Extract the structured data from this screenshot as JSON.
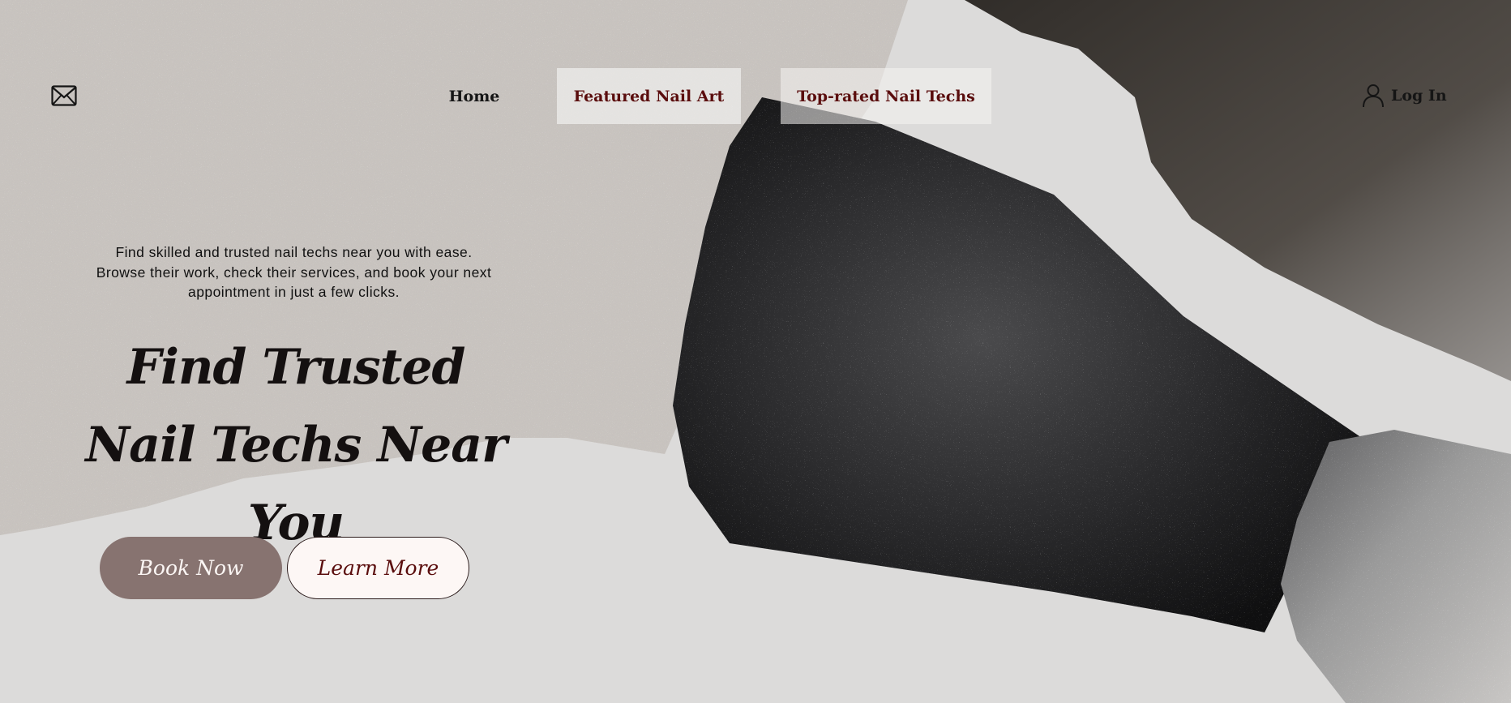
{
  "nav": {
    "mail_icon": "envelope-icon",
    "items": [
      {
        "label": "Home"
      },
      {
        "label": "Featured Nail Art"
      },
      {
        "label": "Top-rated Nail Techs"
      }
    ],
    "login": {
      "label": "Log In",
      "icon": "user-icon"
    }
  },
  "hero": {
    "subtitle": "Find skilled and trusted nail techs near you with ease. Browse their work, check their services, and book your next appointment in just a few clicks.",
    "title": "Find Trusted Nail Techs Near You",
    "buttons": {
      "book": "Book Now",
      "learn": "Learn More"
    }
  },
  "colors": {
    "accent_dark_red": "#5a0d0d",
    "book_button": "#877370",
    "learn_button": "#fdf7f5",
    "background": "#dcdbda"
  }
}
